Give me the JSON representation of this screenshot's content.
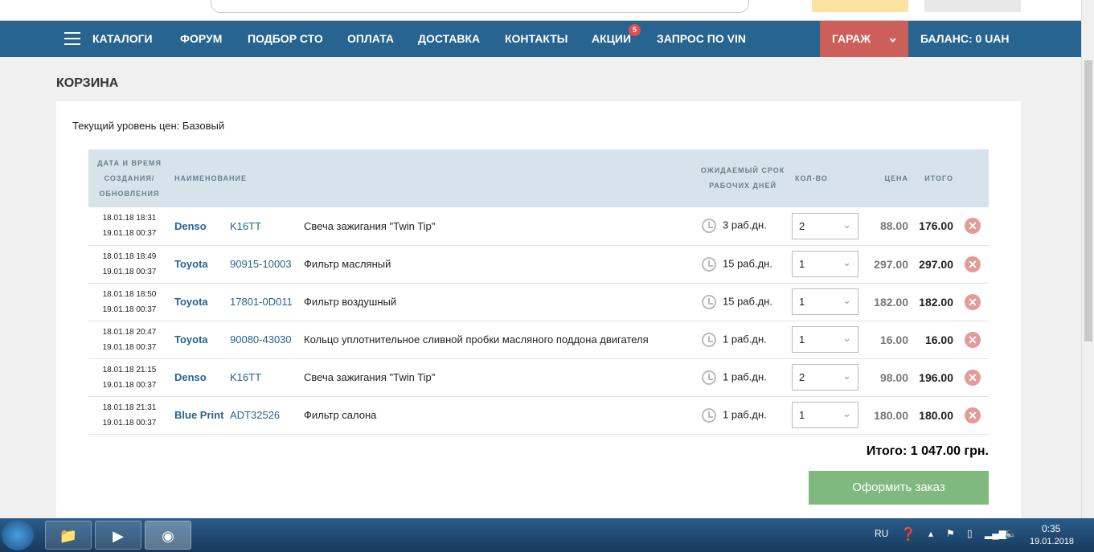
{
  "nav": {
    "items": [
      "КАТАЛОГИ",
      "ФОРУМ",
      "ПОДБОР СТО",
      "ОПЛАТА",
      "ДОСТАВКА",
      "КОНТАКТЫ",
      "АКЦИИ",
      "ЗАПРОС ПО VIN"
    ],
    "promo_badge": "5",
    "garage": "ГАРАЖ",
    "balance": "БАЛАНС: 0 UAH"
  },
  "page": {
    "title": "КОРЗИНА",
    "price_level": "Текущий уровень цен: Базовый"
  },
  "table": {
    "headers": {
      "date1": "ДАТА И ВРЕМЯ",
      "date2": "СОЗДАНИЯ/",
      "date3": "ОБНОВЛЕНИЯ",
      "name": "НАИМЕНОВАНИЕ",
      "term1": "ОЖИДАЕМЫЙ СРОК",
      "term2": "РАБОЧИХ ДНЕЙ",
      "qty": "КОЛ-ВО",
      "price": "ЦЕНА",
      "total": "ИТОГО"
    },
    "rows": [
      {
        "created": "18.01.18 18:31",
        "updated": "19.01.18 00:37",
        "brand": "Denso",
        "article": "K16TT",
        "name": "Свеча зажигания \"Twin Tip\"",
        "term": "3 раб.дн.",
        "qty": "2",
        "price": "88.00",
        "total": "176.00"
      },
      {
        "created": "18.01.18 18:49",
        "updated": "19.01.18 00:37",
        "brand": "Toyota",
        "article": "90915-10003",
        "name": "Фильтр масляный",
        "term": "15 раб.дн.",
        "qty": "1",
        "price": "297.00",
        "total": "297.00"
      },
      {
        "created": "18.01.18 18:50",
        "updated": "19.01.18 00:37",
        "brand": "Toyota",
        "article": "17801-0D011",
        "name": "Фильтр воздушный",
        "term": "15 раб.дн.",
        "qty": "1",
        "price": "182.00",
        "total": "182.00"
      },
      {
        "created": "18.01.18 20:47",
        "updated": "19.01.18 00:37",
        "brand": "Toyota",
        "article": "90080-43030",
        "name": "Кольцо уплотнительное сливной пробки масляного поддона двигателя",
        "term": "1 раб.дн.",
        "qty": "1",
        "price": "16.00",
        "total": "16.00"
      },
      {
        "created": "18.01.18 21:15",
        "updated": "19.01.18 00:37",
        "brand": "Denso",
        "article": "K16TT",
        "name": "Свеча зажигания \"Twin Tip\"",
        "term": "1 раб.дн.",
        "qty": "2",
        "price": "98.00",
        "total": "196.00"
      },
      {
        "created": "18.01.18 21:31",
        "updated": "19.01.18 00:37",
        "brand": "Blue Print",
        "article": "ADT32526",
        "name": "Фильтр салона",
        "term": "1 раб.дн.",
        "qty": "1",
        "price": "180.00",
        "total": "180.00"
      }
    ]
  },
  "summary": {
    "total": "Итого: 1 047.00 грн.",
    "order_button": "Оформить заказ"
  },
  "taskbar": {
    "lang": "RU",
    "time": "0:35",
    "date": "19.01.2018"
  },
  "colors": {
    "nav": "#27648f",
    "garage": "#cd5f5b",
    "order": "#80b97f"
  }
}
